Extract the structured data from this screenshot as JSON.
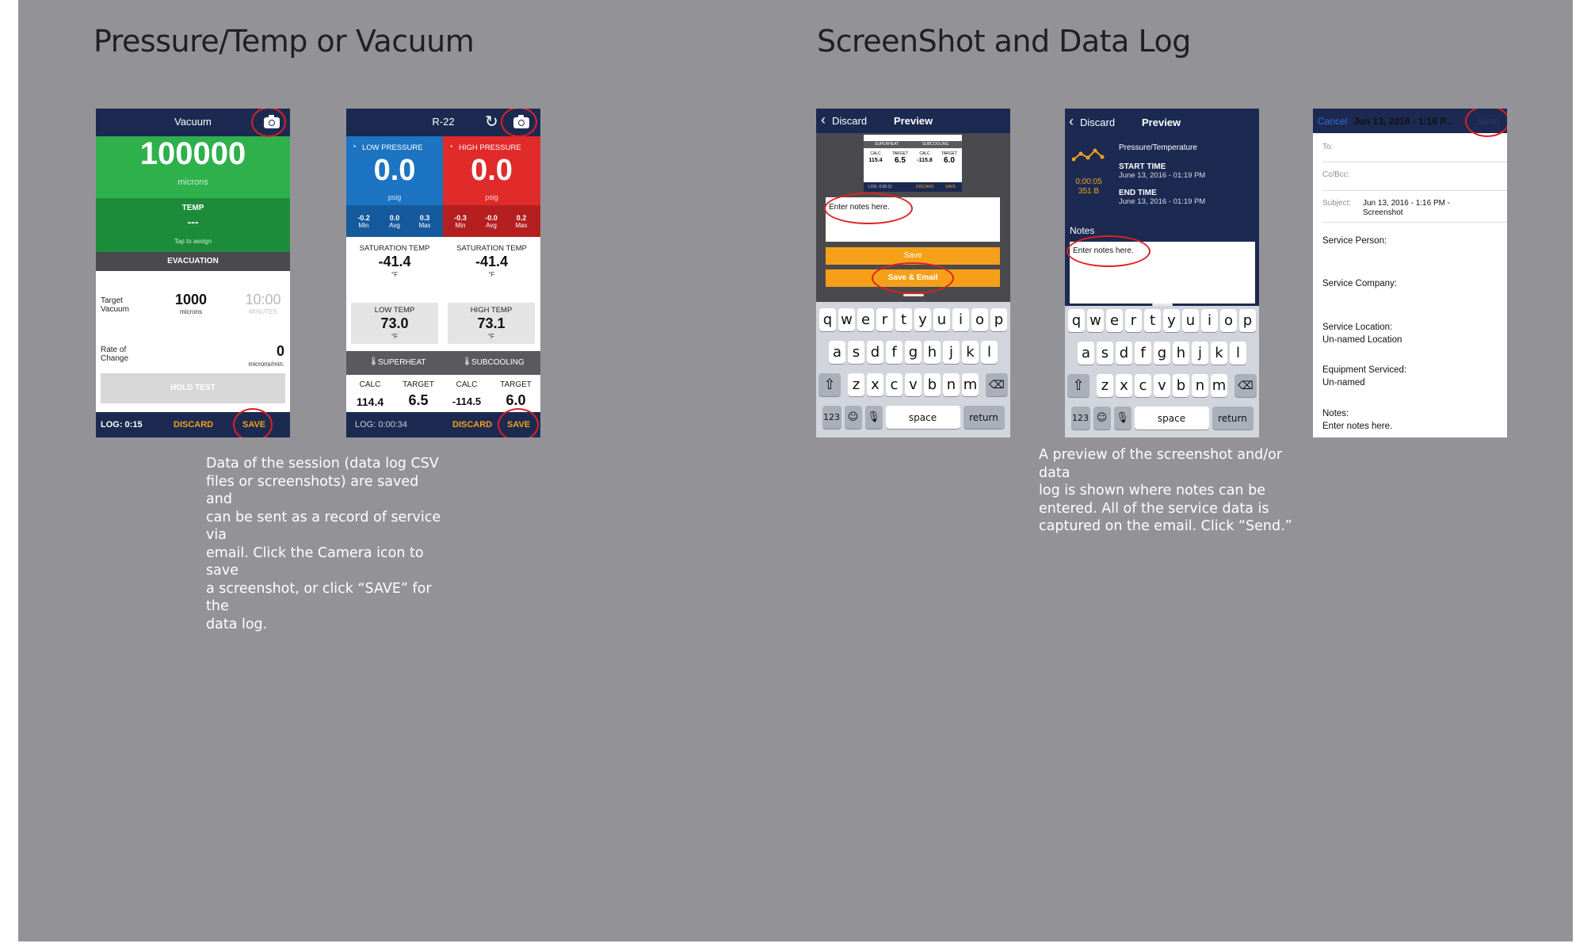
{
  "headings": {
    "left": "Pressure/Temp or Vacuum",
    "right": "ScreenShot and Data Log"
  },
  "captions": {
    "left": [
      "Data of the session (data log CSV",
      "files or screenshots) are saved and",
      "can be sent as a record of service via",
      "email. Click the Camera icon to save",
      "a screenshot, or click “SAVE” for the",
      "data log."
    ],
    "right": [
      "A preview of the screenshot and/or data",
      "log is shown where notes can be",
      "entered. All of the service data is",
      "captured on the email. Click “Send.”"
    ]
  },
  "vacuum_screen": {
    "title": "Vacuum",
    "value": "100000",
    "unit": "microns",
    "temp_label": "TEMP",
    "temp_value": "---",
    "temp_hint": "Tap to assign",
    "evacuation": "EVACUATION",
    "target_label": "Target Vacuum",
    "target_value": "1000",
    "target_unit": "microns",
    "timer_value": "10:00",
    "timer_unit": "MINUTES",
    "rate_label": "Rate of Change",
    "rate_value": "0",
    "rate_unit": "microns/min.",
    "hold_test": "HOLD TEST",
    "log": "LOG: 0:15",
    "discard": "DISCARD",
    "save": "SAVE",
    "colors": {
      "green": "#2eb04b",
      "dark_green": "#1d8c3a",
      "navy": "#1c2a52",
      "orange": "#f6a01a"
    }
  },
  "pt_screen": {
    "title": "R-22",
    "low_label": "LOW PRESSURE",
    "high_label": "HIGH PRESSURE",
    "low_value": "0.0",
    "high_value": "0.0",
    "unit": "psig",
    "low_stats": [
      {
        "v": "-0.2",
        "l": "Min"
      },
      {
        "v": "0.0",
        "l": "Avg"
      },
      {
        "v": "0.3",
        "l": "Max"
      }
    ],
    "high_stats": [
      {
        "v": "-0.3",
        "l": "Min"
      },
      {
        "v": "-0.0",
        "l": "Avg"
      },
      {
        "v": "0.2",
        "l": "Max"
      }
    ],
    "sat_label": "SATURATION TEMP",
    "sat_low": "-41.4",
    "sat_high": "-41.4",
    "deg_f": "°F",
    "low_temp_label": "LOW TEMP",
    "low_temp": "73.0",
    "high_temp_label": "HIGH TEMP",
    "high_temp": "73.1",
    "superheat": "SUPERHEAT",
    "subcooling": "SUBCOOLING",
    "calc_label": "CALC",
    "target_label": "TARGET",
    "sh_calc": "114.4",
    "sh_target": "6.5",
    "sc_calc": "-114.5",
    "sc_target": "6.0",
    "log": "LOG: 0:00:34",
    "discard": "DISCARD",
    "save": "SAVE",
    "colors": {
      "blue": "#1d74c2",
      "red": "#e12a2a",
      "dark_red": "#b51f1f",
      "dark_blue": "#155a9c"
    }
  },
  "preview1": {
    "back": "Discard",
    "title": "Preview",
    "thumb": {
      "superheat": "SUPERHEAT",
      "subcooling": "SUBCOOLING",
      "calc": "CALC",
      "target": "TARGET",
      "v1": "115.4",
      "v2": "6.5",
      "v3": "-115.8",
      "v4": "6.0",
      "log": "LOG: 0:00:11",
      "discard": "DISCARD",
      "save": "SAVE"
    },
    "notes_placeholder": "Enter notes here.",
    "save": "Save",
    "save_email": "Save & Email"
  },
  "preview2": {
    "back": "Discard",
    "title": "Preview",
    "session_type": "Pressure/Temperature",
    "duration": "0:00:05",
    "size": "351 B",
    "start_label": "START TIME",
    "start_value": "June 13, 2016 - 01:19 PM",
    "end_label": "END TIME",
    "end_value": "June 13, 2016 - 01:19 PM",
    "notes_label": "Notes",
    "notes_placeholder": "Enter notes here."
  },
  "keyboard": {
    "row1": [
      "q",
      "w",
      "e",
      "r",
      "t",
      "y",
      "u",
      "i",
      "o",
      "p"
    ],
    "row2": [
      "a",
      "s",
      "d",
      "f",
      "g",
      "h",
      "j",
      "k",
      "l"
    ],
    "row3": [
      "z",
      "x",
      "c",
      "v",
      "b",
      "n",
      "m"
    ],
    "numbers": "123",
    "space": "space",
    "return": "return"
  },
  "email": {
    "cancel": "Cancel",
    "title": "Jun 13, 2016 - 1:16 P...",
    "send": "Send",
    "to_label": "To:",
    "cc_label": "Cc/Bcc:",
    "subject_label": "Subject:",
    "subject_value": "Jun 13, 2016 - 1:16 PM - Screenshot",
    "service_person": "Service Person:",
    "service_company": "Service Company:",
    "service_location": "Service Location:",
    "location_value": "Un-named Location",
    "equipment_label": "Equipment Serviced:",
    "equipment_value": "Un-named",
    "notes_label": "Notes:",
    "notes_value": "Enter notes here."
  }
}
